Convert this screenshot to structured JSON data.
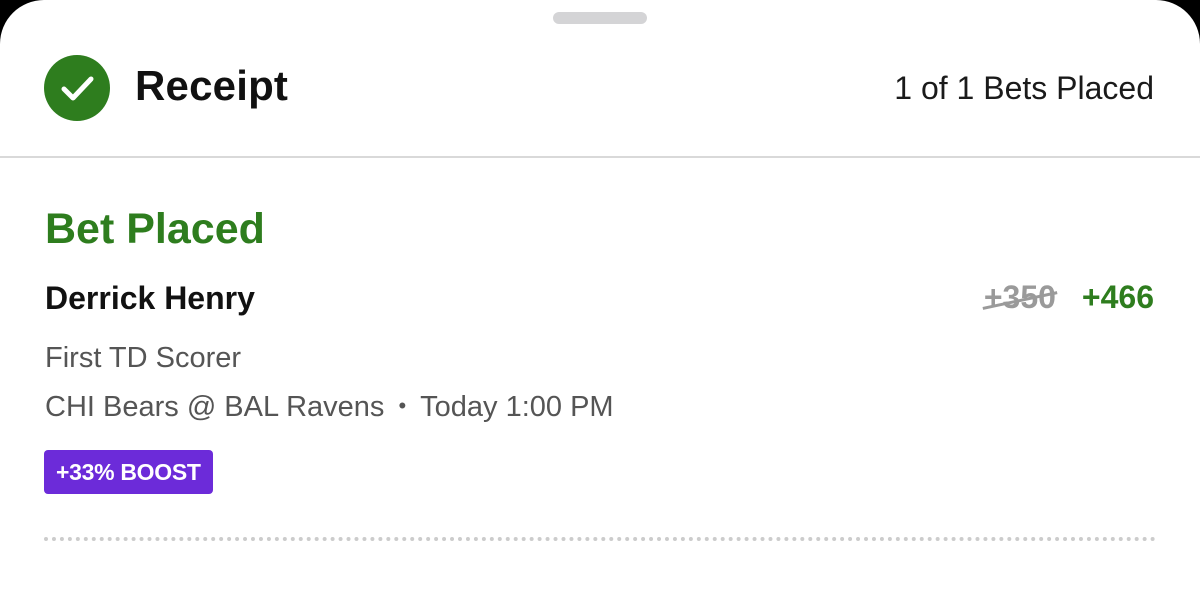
{
  "header": {
    "title": "Receipt",
    "bets_placed": "1 of 1 Bets Placed"
  },
  "bet": {
    "status": "Bet Placed",
    "player": "Derrick Henry",
    "original_odds": "+350",
    "boosted_odds": "+466",
    "market": "First TD Scorer",
    "matchup": "CHI Bears @ BAL Ravens",
    "separator": "•",
    "time": "Today 1:00 PM",
    "boost_label": "+33% BOOST"
  },
  "icons": {
    "status": "check-circle-icon"
  },
  "colors": {
    "success_green": "#2e7d1e",
    "boost_purple": "#6c2bd9",
    "muted_text": "#555555",
    "strikethrough_gray": "#9a9a9a"
  }
}
